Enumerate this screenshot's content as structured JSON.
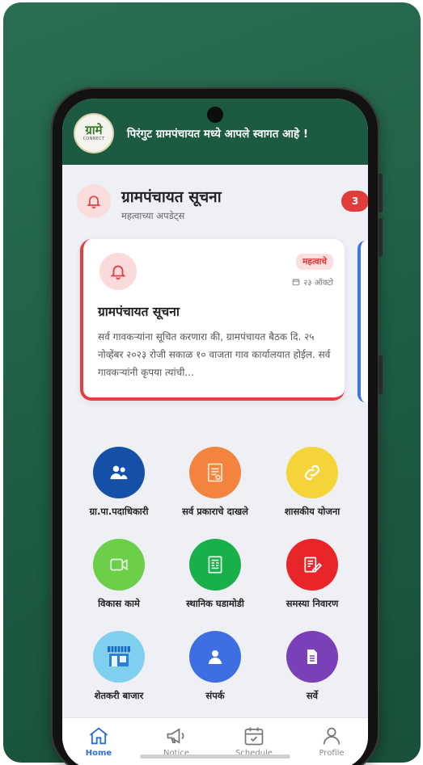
{
  "header": {
    "logo_text_main": "ग्रामे",
    "logo_text_sub": "CONNECT",
    "welcome_text": "पिरंगुट ग्रामपंचायत मध्ये आपले स्वागत आहे !"
  },
  "notice_section": {
    "title": "ग्रामपंचायत सूचना",
    "subtitle": "महत्वाच्या अपडेट्स",
    "count": "3"
  },
  "notice_card": {
    "tag": "महत्वाचे",
    "date": "२३ ऑक्टो",
    "title": "ग्रामपंचायत सूचना",
    "body": "सर्व गावकऱ्यांना सूचित करणारा की, ग्रामपंचायत बैठक दि. २५ नोव्हेंबर २०२३ रोजी सकाळ १० वाजता गाव कार्यालयात होईल. सर्व गावकऱ्यांनी कृपया त्यांची..."
  },
  "services": [
    {
      "label": "ग्रा.पा.पदाधिकारी",
      "icon": "people-icon",
      "color": "#1450a8"
    },
    {
      "label": "सर्व प्रकाराचे दाखले",
      "icon": "certificate-icon",
      "color": "#f4833e"
    },
    {
      "label": "शासकीय योजना",
      "icon": "link-icon",
      "color": "#f5d43a"
    },
    {
      "label": "विकास कामे",
      "icon": "camera-icon",
      "color": "#6bcf4a"
    },
    {
      "label": "स्थानिक घडामोडी",
      "icon": "newspaper-icon",
      "color": "#19b04a"
    },
    {
      "label": "समस्या निवारण",
      "icon": "edit-document-icon",
      "color": "#e8262a"
    },
    {
      "label": "शेतकरी बाजार",
      "icon": "shop-icon",
      "color": "#7ed0ee"
    },
    {
      "label": "संपर्क",
      "icon": "person-icon",
      "color": "#3f6ee2"
    },
    {
      "label": "सर्वे",
      "icon": "survey-icon",
      "color": "#7a40b8"
    }
  ],
  "bottom_nav": [
    {
      "label": "Home",
      "icon": "home-icon",
      "active": true
    },
    {
      "label": "Notice",
      "icon": "megaphone-icon",
      "active": false
    },
    {
      "label": "Schedule",
      "icon": "calendar-icon",
      "active": false
    },
    {
      "label": "Profile",
      "icon": "user-icon",
      "active": false
    }
  ]
}
